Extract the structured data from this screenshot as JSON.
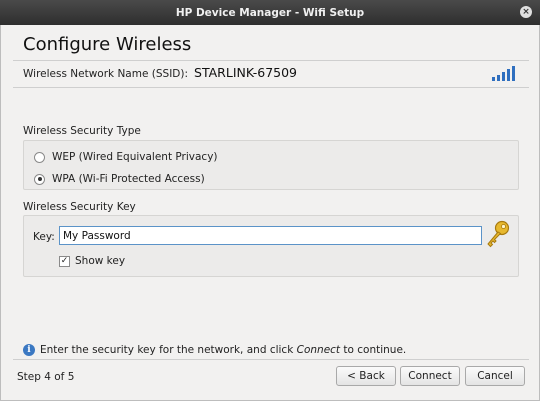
{
  "window": {
    "title": "HP Device Manager - Wifi Setup",
    "close_glyph": "×"
  },
  "page": {
    "title": "Configure Wireless"
  },
  "network": {
    "ssid_label": "Wireless Network Name (SSID):",
    "ssid_value": "STARLINK-67509",
    "signal_icon": "wifi-signal-strength-icon"
  },
  "security_type": {
    "label": "Wireless Security Type",
    "options": [
      {
        "label": "WEP (Wired Equivalent Privacy)",
        "selected": false
      },
      {
        "label": "WPA (Wi-Fi Protected Access)",
        "selected": true
      }
    ]
  },
  "security_key": {
    "label": "Wireless Security Key",
    "key_label": "Key:",
    "key_value": "My Password",
    "key_icon": "key-icon",
    "show_key_label": "Show key",
    "show_key_checked": true
  },
  "info": {
    "text_before": "Enter the security key for the network, and click ",
    "text_emphasis": "Connect",
    "text_after": " to continue."
  },
  "footer": {
    "step_text": "Step 4 of 5",
    "back_label": "< Back",
    "connect_label": "Connect",
    "cancel_label": "Cancel"
  },
  "colors": {
    "titlebar": "#3a3a3a",
    "window_bg": "#f2f1f0",
    "input_focus_border": "#5b93c8",
    "signal_bars": "#2f6fbf",
    "key_gold": "#d9a520",
    "info_blue": "#3b78c2"
  }
}
